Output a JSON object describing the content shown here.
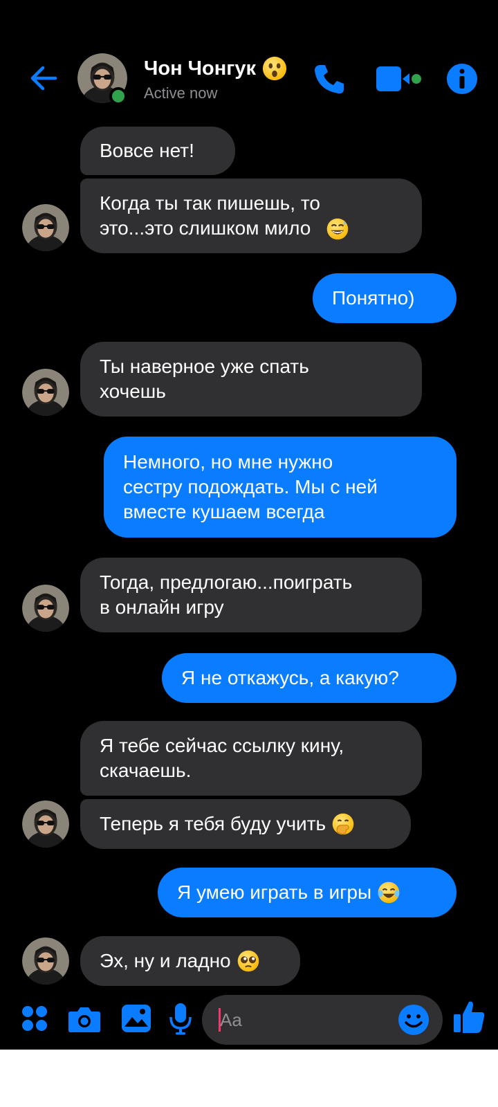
{
  "header": {
    "contact_name": "Чон Чонгук",
    "status": "Active now",
    "name_emoji_icon": "astonished-face-icon",
    "icons": [
      "back-arrow-icon",
      "phone-icon",
      "video-camera-icon",
      "info-icon"
    ]
  },
  "messages": [
    {
      "from": "them",
      "text": "Вовсе нет!"
    },
    {
      "from": "them",
      "text": "Когда ты так пишешь, то\nэто...это слишком мило",
      "emoji": "grinning-sweat-face-icon"
    },
    {
      "from": "me",
      "text": "Понятно)"
    },
    {
      "from": "them",
      "text": "Ты наверное уже спать\nхочешь"
    },
    {
      "from": "me",
      "text": "Немного, но мне нужно\nсестру подождать. Мы с ней\nвместе кушаем всегда"
    },
    {
      "from": "them",
      "text": "Тогда, предлогаю...поиграть\nв онлайн игру"
    },
    {
      "from": "me",
      "text": "Я не откажусь, а какую?"
    },
    {
      "from": "them",
      "text": "Я тебе сейчас ссылку кину,\nскачаешь."
    },
    {
      "from": "them",
      "text": "Теперь я тебя буду учить",
      "emoji": "hand-over-mouth-face-icon"
    },
    {
      "from": "me",
      "text": "Я умею играть в игры",
      "emoji": "tears-of-joy-face-icon"
    },
    {
      "from": "them",
      "text": "Эх, ну и ладно",
      "emoji": "pleading-face-icon"
    }
  ],
  "composer": {
    "placeholder": "Aa",
    "icons": [
      "apps-grid-icon",
      "camera-icon",
      "gallery-icon",
      "microphone-icon",
      "emoji-icon",
      "thumbs-up-icon"
    ]
  },
  "colors": {
    "background": "#000000",
    "incoming_bubble": "#303033",
    "outgoing_bubble": "#0a7cff",
    "accent": "#0a7cff",
    "online": "#31a24c"
  }
}
